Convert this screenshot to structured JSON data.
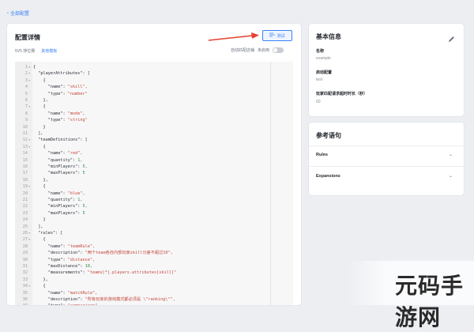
{
  "breadcrumb": {
    "icon": "chevron-left-icon",
    "label": "全部配置"
  },
  "main": {
    "title": "配置详情",
    "tabs": [
      {
        "label": "5V5 排位赛",
        "active": false
      },
      {
        "label": "其他模板",
        "active": true
      }
    ],
    "test_button": {
      "label": "测试",
      "icon": "test-icon"
    },
    "auto_match": {
      "label": "自动匹配店铺",
      "state_label": "未启用",
      "enabled": false
    }
  },
  "editor_lines": [
    {
      "n": "1",
      "fold": "▾",
      "text": "{"
    },
    {
      "n": "2",
      "fold": "▾",
      "text": "  \"playerAttributes\": ["
    },
    {
      "n": "3",
      "fold": "▾",
      "text": "    {"
    },
    {
      "n": "4",
      "fold": "",
      "text": "      \"name\": \"skill\","
    },
    {
      "n": "5",
      "fold": "",
      "text": "      \"type\": \"number\""
    },
    {
      "n": "6",
      "fold": "",
      "text": "    },"
    },
    {
      "n": "7",
      "fold": "▾",
      "text": "    {"
    },
    {
      "n": "8",
      "fold": "",
      "text": "      \"name\": \"mode\","
    },
    {
      "n": "9",
      "fold": "",
      "text": "      \"type\": \"string\""
    },
    {
      "n": "10",
      "fold": "",
      "text": "    }"
    },
    {
      "n": "11",
      "fold": "",
      "text": "  ],"
    },
    {
      "n": "12",
      "fold": "▾",
      "text": "  \"teamDefinitions\": ["
    },
    {
      "n": "13",
      "fold": "▾",
      "text": "    {"
    },
    {
      "n": "14",
      "fold": "",
      "text": "      \"name\": \"red\","
    },
    {
      "n": "15",
      "fold": "",
      "text": "      \"quantity\": 1,"
    },
    {
      "n": "16",
      "fold": "",
      "text": "      \"minPlayers\": 5,"
    },
    {
      "n": "17",
      "fold": "",
      "text": "      \"maxPlayers\": 5"
    },
    {
      "n": "18",
      "fold": "",
      "text": "    },"
    },
    {
      "n": "19",
      "fold": "▾",
      "text": "    {"
    },
    {
      "n": "20",
      "fold": "",
      "text": "      \"name\": \"blue\","
    },
    {
      "n": "21",
      "fold": "",
      "text": "      \"quantity\": 1,"
    },
    {
      "n": "22",
      "fold": "",
      "text": "      \"minPlayers\": 5,"
    },
    {
      "n": "23",
      "fold": "",
      "text": "      \"maxPlayers\": 5"
    },
    {
      "n": "24",
      "fold": "",
      "text": "    }"
    },
    {
      "n": "25",
      "fold": "",
      "text": "  ],"
    },
    {
      "n": "26",
      "fold": "▾",
      "text": "  \"rules\": ["
    },
    {
      "n": "27",
      "fold": "▾",
      "text": "    {"
    },
    {
      "n": "28",
      "fold": "",
      "text": "      \"name\": \"teamRule\","
    },
    {
      "n": "29",
      "fold": "",
      "text": "      \"description\": \"两个team各自内部玩家skill分差不超过10\","
    },
    {
      "n": "30",
      "fold": "",
      "text": "      \"type\": \"distance\","
    },
    {
      "n": "31",
      "fold": "",
      "text": "      \"maxDistance\": 10,"
    },
    {
      "n": "32",
      "fold": "",
      "text": "      \"measurements\": \"teams[*].players.attributes[skill]\""
    },
    {
      "n": "33",
      "fold": "",
      "text": "    },"
    },
    {
      "n": "34",
      "fold": "▾",
      "text": "    {"
    },
    {
      "n": "35",
      "fold": "",
      "text": "      \"name\": \"matchRule\","
    },
    {
      "n": "36",
      "fold": "",
      "text": "      \"description\": \"所有玩家的游戏模式都必须是 \\\"ranking\\\"\","
    },
    {
      "n": "37",
      "fold": "",
      "text": "      \"type\": \"comparison\","
    }
  ],
  "info": {
    "title": "基本信息",
    "edit_icon": "pencil-icon",
    "fields": [
      {
        "label": "名称",
        "value": "example"
      },
      {
        "label": "启动配置",
        "value": "test"
      },
      {
        "label": "玩家匹配请求超时时长（秒）",
        "value": "60"
      }
    ]
  },
  "reference": {
    "title": "参考语句",
    "items": [
      {
        "label": "Rules",
        "icon": "chevron-down-icon"
      },
      {
        "label": "Expansions",
        "icon": "chevron-down-icon"
      }
    ]
  },
  "watermark": {
    "text": "元码手游网"
  },
  "colors": {
    "accent": "#3c82f6",
    "arrow": "#e5412d",
    "string": "#c4473a",
    "number": "#2f8a45"
  }
}
